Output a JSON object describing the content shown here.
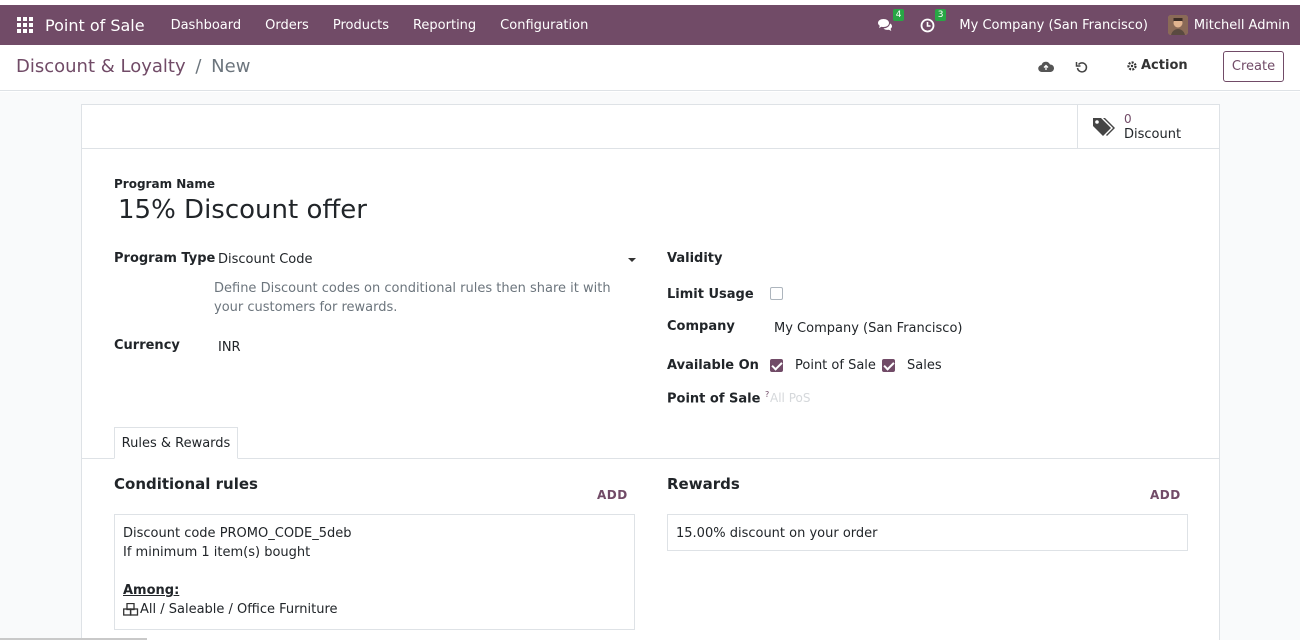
{
  "topbar": {
    "app_name": "Point of Sale",
    "menu": [
      "Dashboard",
      "Orders",
      "Products",
      "Reporting",
      "Configuration"
    ],
    "messages_count": "4",
    "activities_count": "3",
    "company": "My Company (San Francisco)",
    "user": "Mitchell Admin",
    "color": "#714B67"
  },
  "breadcrumb": {
    "parent": "Discount & Loyalty",
    "separator": "/",
    "current": "New"
  },
  "control": {
    "action_label": "Action",
    "create_label": "Create"
  },
  "stat_button": {
    "value": "0",
    "label": "Discount"
  },
  "form": {
    "program_name_label": "Program Name",
    "program_name": "15% Discount offer",
    "program_type_label": "Program Type",
    "program_type": "Discount Code",
    "program_type_help": "Define Discount codes on conditional rules then share it with your customers for rewards.",
    "currency_label": "Currency",
    "currency": "INR",
    "validity_label": "Validity",
    "limit_usage_label": "Limit Usage",
    "limit_usage_checked": false,
    "company_label": "Company",
    "company": "My Company (San Francisco)",
    "available_on_label": "Available On",
    "available_on": [
      {
        "label": "Point of Sale",
        "checked": true
      },
      {
        "label": "Sales",
        "checked": true
      }
    ],
    "pos_label": "Point of Sale",
    "pos_help_mark": "?",
    "pos_placeholder": "All PoS"
  },
  "tabs": {
    "active": "Rules & Rewards"
  },
  "rules": {
    "title": "Conditional rules",
    "add_label": "ADD",
    "line1": "Discount code PROMO_CODE_5deb",
    "line2": "If minimum 1 item(s) bought",
    "among_label": "Among:",
    "category": "All / Saleable / Office Furniture"
  },
  "rewards": {
    "title": "Rewards",
    "add_label": "ADD",
    "item": "15.00% discount on your order"
  }
}
